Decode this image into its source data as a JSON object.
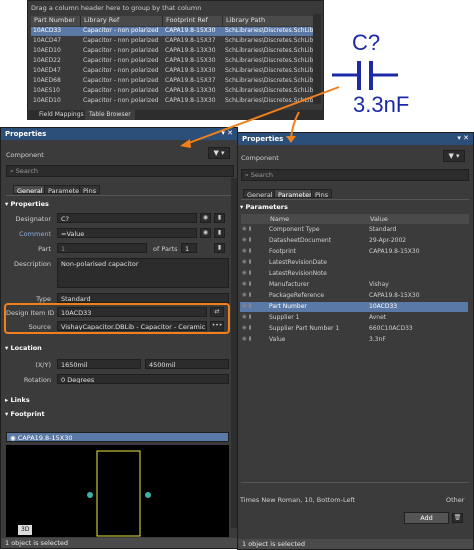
{
  "table": {
    "group_hint": "Drag a column header here to group by that column",
    "columns": [
      "Part Number",
      "Library Ref",
      "Footprint Ref",
      "Library Path"
    ],
    "rows": [
      [
        "10ACD33",
        "Capacitor - non polarized",
        "CAPA19.8-15X30",
        "SchLibraries\\Discretes.SchLib"
      ],
      [
        "10ACD47",
        "Capacitor - non polarized",
        "CAPA19.8-15X37",
        "SchLibraries\\Discretes.SchLib"
      ],
      [
        "10AED10",
        "Capacitor - non polarized",
        "CAPA19.8-13X30",
        "SchLibraries\\Discretes.SchLib"
      ],
      [
        "10AED22",
        "Capacitor - non polarized",
        "CAPA19.8-15X30",
        "SchLibraries\\Discretes.SchLib"
      ],
      [
        "10AED47",
        "Capacitor - non polarized",
        "CAPA19.8-13X30",
        "SchLibraries\\Discretes.SchLib"
      ],
      [
        "10AED68",
        "Capacitor - non polarized",
        "CAPA19.8-15X37",
        "SchLibraries\\Discretes.SchLib"
      ],
      [
        "10AES10",
        "Capacitor - non polarized",
        "CAPA19.8-13X30",
        "SchLibraries\\Discretes.SchLib"
      ],
      [
        "10AED10",
        "Capacitor - non polarized",
        "CAPA19.8-13X30",
        "SchLibraries\\Discretes.SchLib"
      ]
    ],
    "tabs": [
      "Field Mappings",
      "Table Browser"
    ]
  },
  "symbol": {
    "designator": "C?",
    "value": "3.3nF"
  },
  "left": {
    "title": "Properties",
    "title_ctrl": "▾ ✕",
    "filter_label": "Component",
    "search_placeholder": "Search",
    "tabs": [
      "General",
      "Parameters",
      "Pins"
    ],
    "properties_section": "Properties",
    "designator_label": "Designator",
    "designator_value": "C?",
    "comment_label": "Comment",
    "comment_value": "=Value",
    "part_label": "Part",
    "part_value": "1",
    "of_parts": "of Parts",
    "of_parts_value": "1",
    "description_label": "Description",
    "description_value": "Non-polarised capacitor",
    "type_label": "Type",
    "type_value": "Standard",
    "design_item_label": "Design Item ID",
    "design_item_value": "10ACD33",
    "source_label": "Source",
    "source_value": "VishayCapacitor.DBLib - Capacitor - Ceramic",
    "location_section": "Location",
    "xy_label": "(X/Y)",
    "x_value": "1650mil",
    "y_value": "4500mil",
    "rotation_label": "Rotation",
    "rotation_value": "0 Degrees",
    "links_section": "Links",
    "footprint_section": "Footprint",
    "footprint_name": "CAPA19.8-15X30",
    "view_3d": "3D",
    "status": "1 object is selected"
  },
  "right": {
    "title": "Properties",
    "title_ctrl": "▾ ✕",
    "filter_label": "Component",
    "search_placeholder": "Search",
    "tabs": [
      "General",
      "Parameters",
      "Pins"
    ],
    "params_section": "Parameters",
    "col_name": "Name",
    "col_value": "Value",
    "params": [
      [
        "Component Type",
        "Standard"
      ],
      [
        "DatasheetDocument",
        "29-Apr-2002"
      ],
      [
        "Footprint",
        "CAPA19.8-15X30"
      ],
      [
        "LatestRevisionDate",
        ""
      ],
      [
        "LatestRevisionNote",
        ""
      ],
      [
        "Manufacturer",
        "Vishay"
      ],
      [
        "PackageReference",
        "CAPA19.8-15X30"
      ],
      [
        "Part Number",
        "10ACD33"
      ],
      [
        "Supplier 1",
        "Avnet"
      ],
      [
        "Supplier Part Number 1",
        "660C10ACD33"
      ],
      [
        "Value",
        "3.3nF"
      ]
    ],
    "selected_index": 7,
    "font_info": "Times New Roman, 10, Bottom-Left",
    "other_label": "Other",
    "add_label": "Add",
    "status": "1 object is selected"
  },
  "colors": {
    "accent": "#f07f1c",
    "selection": "#5b79a6",
    "title_bar": "#2b4f79",
    "symbol": "#1c2aa8"
  }
}
